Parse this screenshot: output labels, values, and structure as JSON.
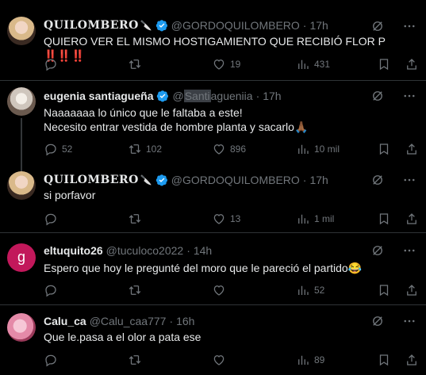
{
  "tweets": [
    {
      "name": "QUILOMBERO",
      "name_emoji": "🔪",
      "handle": "@GORDOQUILOMBERO",
      "time": "17h",
      "text": "QUIERO VER EL MISMO HOSTIGAMIENTO QUE RECIBIÓ FLOR P",
      "text_suffix": "‼️‼️‼️",
      "counts": {
        "reply": "",
        "retweet": "",
        "like": "19",
        "views": "431"
      }
    },
    {
      "name": "eugenia santiagueña",
      "handle_prefix": "@",
      "handle_highlight": "Santi",
      "handle_rest": "agueniia",
      "time": "17h",
      "text_line1": "Naaaaaaa lo único que le faltaba a este!",
      "text_line2": "Necesito entrar vestida de hombre planta y sacarlo🙏🏾",
      "counts": {
        "reply": "52",
        "retweet": "102",
        "like": "896",
        "views": "10 mil"
      }
    },
    {
      "name": "QUILOMBERO",
      "name_emoji": "🔪",
      "handle": "@GORDOQUILOMBERO",
      "time": "17h",
      "text": "si porfavor",
      "counts": {
        "reply": "",
        "retweet": "",
        "like": "13",
        "views": "1 mil"
      }
    },
    {
      "avatar_letter": "g",
      "name": "eltuquito26",
      "handle": "@tuculoco2022",
      "time": "14h",
      "text": "Espero que hoy le pregunté del moro que le pareció el partido😂",
      "counts": {
        "reply": "",
        "retweet": "",
        "like": "",
        "views": "52"
      }
    },
    {
      "name": "Calu_ca",
      "handle": "@Calu_caa777",
      "time": "16h",
      "text": "Que le.pasa a el olor a pata ese",
      "counts": {
        "reply": "",
        "retweet": "",
        "like": "",
        "views": "89"
      }
    }
  ],
  "colors": {
    "background": "#000000",
    "text": "#e7e9ea",
    "muted": "#71767b",
    "separator": "#2f3336",
    "verified": "#1d9bf0"
  },
  "icons": [
    "reply-icon",
    "retweet-icon",
    "like-icon",
    "views-icon",
    "bookmark-icon",
    "share-icon",
    "grok-icon",
    "more-icon",
    "verified-badge-icon"
  ]
}
